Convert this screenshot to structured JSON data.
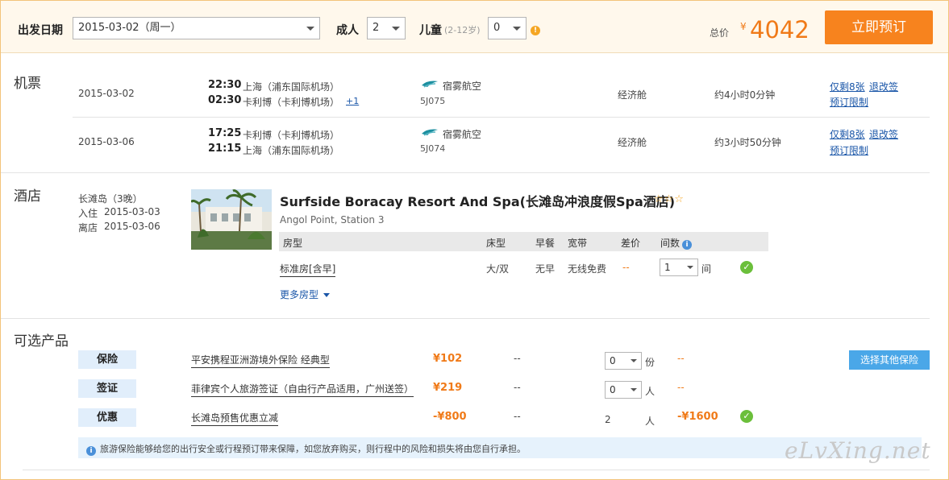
{
  "topbar": {
    "date_label": "出发日期",
    "date_value": "2015-03-02（周一）",
    "adult_label": "成人",
    "adult_value": "2",
    "child_label": "儿童",
    "child_age": "(2-12岁)",
    "child_value": "0",
    "total_label": "总价",
    "currency": "¥",
    "total_price": "4042",
    "book_button": "立即预订"
  },
  "flights": {
    "section_title": "机票",
    "rows": [
      {
        "date": "2015-03-02",
        "dep_time": "22:30",
        "dep_airport": "上海（浦东国际机场）",
        "arr_time": "02:30",
        "arr_airport": "卡利博（卡利博机场）",
        "next_day": "+1",
        "airline": "宿雾航空",
        "flight_no": "5J075",
        "cabin": "经济舱",
        "duration": "约4小时0分钟",
        "seats": "仅剩8张",
        "change": "退改签",
        "rules": "预订限制"
      },
      {
        "date": "2015-03-06",
        "dep_time": "17:25",
        "dep_airport": "卡利博（卡利博机场）",
        "arr_time": "21:15",
        "arr_airport": "上海（浦东国际机场）",
        "next_day": "",
        "airline": "宿雾航空",
        "flight_no": "5J074",
        "cabin": "经济舱",
        "duration": "约3小时50分钟",
        "seats": "仅剩8张",
        "change": "退改签",
        "rules": "预订限制"
      }
    ]
  },
  "hotel": {
    "section_title": "酒店",
    "destination": "长滩岛（3晚）",
    "checkin_label": "入住",
    "checkin_date": "2015-03-03",
    "checkout_label": "离店",
    "checkout_date": "2015-03-06",
    "name": "Surfside Boracay Resort And Spa(长滩岛冲浪度假Spa酒店)",
    "stars": "☆☆☆",
    "address": "Angol Point, Station 3",
    "columns": [
      "房型",
      "床型",
      "早餐",
      "宽带",
      "差价",
      "间数"
    ],
    "room": {
      "type": "标准房[含早]",
      "bed": "大/双",
      "breakfast": "无早",
      "internet": "无线免费",
      "diff": "--",
      "count": "1",
      "unit": "间"
    },
    "more_rooms": "更多房型"
  },
  "options": {
    "section_title": "可选产品",
    "rows": [
      {
        "tag": "保险",
        "name": "平安携程亚洲游境外保险 经典型",
        "price": "¥102",
        "dash": "--",
        "qty": "0",
        "unit": "份",
        "subtotal": "--"
      },
      {
        "tag": "签证",
        "name": "菲律宾个人旅游签证（自由行产品适用，广州送签）",
        "price": "¥219",
        "dash": "--",
        "qty": "0",
        "unit": "人",
        "subtotal": "--"
      },
      {
        "tag": "优惠",
        "name": "长滩岛预售优惠立减",
        "price": "-¥800",
        "dash": "--",
        "qty": "2",
        "unit": "人",
        "subtotal": "-¥1600"
      }
    ],
    "other_insurance_button": "选择其他保险",
    "notice": "旅游保险能够给您的出行安全或行程预订带来保障，如您放弃购买，则行程中的风险和损失将由您自行承担。"
  },
  "watermark": "eLvXing.net",
  "colors": {
    "accent_orange": "#f7831e",
    "price_orange": "#f07a18",
    "link_blue": "#1a56a8",
    "button_blue": "#4aa7e8",
    "check_green": "#6bbf3b"
  }
}
